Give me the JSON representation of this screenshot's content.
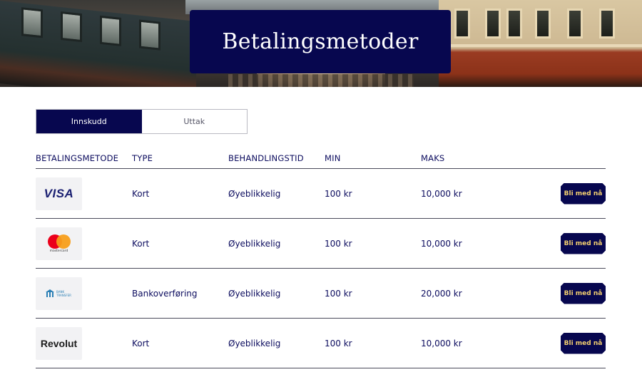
{
  "banner": {
    "title": "Betalingsmetoder"
  },
  "tabs": [
    {
      "label": "Innskudd",
      "active": true
    },
    {
      "label": "Uttak",
      "active": false
    }
  ],
  "table": {
    "headers": [
      "BETALINGSMETODE",
      "TYPE",
      "BEHANDLINGSTID",
      "MIN",
      "MAKS"
    ],
    "rows": [
      {
        "logo": "visa-logo",
        "logo_text": "VISA",
        "type": "Kort",
        "time": "Øyeblikkelig",
        "min": "100 kr",
        "max": "10,000 kr",
        "button": "Bli med nå"
      },
      {
        "logo": "mastercard-logo",
        "logo_text": "mastercard",
        "type": "Kort",
        "time": "Øyeblikkelig",
        "min": "100 kr",
        "max": "10,000 kr",
        "button": "Bli med nå"
      },
      {
        "logo": "bank-transfer-logo",
        "logo_text": "BANK TRANSFER",
        "type": "Bankoverføring",
        "time": "Øyeblikkelig",
        "min": "100 kr",
        "max": "20,000 kr",
        "button": "Bli med nå"
      },
      {
        "logo": "revolut-logo",
        "logo_text": "Revolut",
        "type": "Kort",
        "time": "Øyeblikkelig",
        "min": "100 kr",
        "max": "10,000 kr",
        "button": "Bli med nå"
      }
    ]
  },
  "colors": {
    "brand_navy": "#07074f",
    "button_text": "#f4d070",
    "text": "#0b0b5e"
  }
}
